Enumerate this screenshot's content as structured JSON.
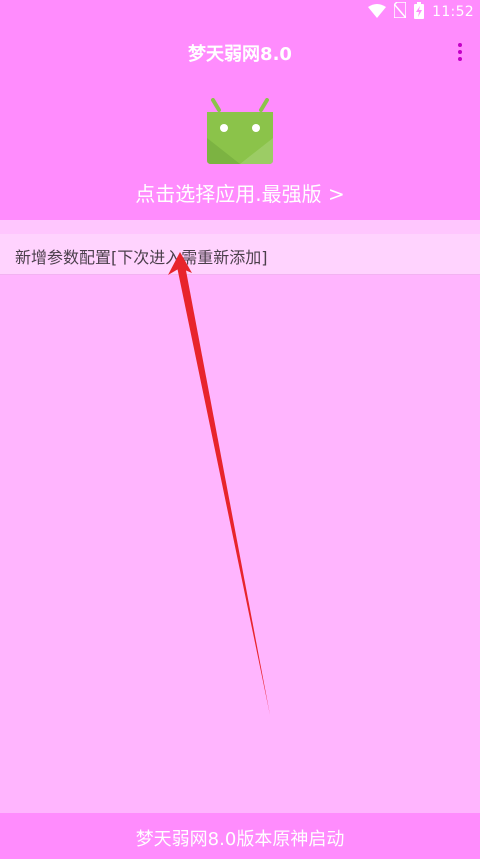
{
  "status_bar": {
    "time": "11:52",
    "icons": [
      "wifi-icon",
      "no-sim-icon",
      "battery-charging-icon"
    ]
  },
  "app_bar": {
    "title": "梦天弱网8.0",
    "menu_icon": "overflow-menu-icon"
  },
  "header": {
    "logo_icon": "android-icon",
    "select_app_label": "点击选择应用.最强版 >"
  },
  "list": {
    "items": [
      {
        "label": "新增参数配置[下次进入需重新添加]"
      }
    ]
  },
  "annotation": {
    "type": "red-arrow",
    "color": "#e8242c"
  },
  "bottom_bar": {
    "label": "梦天弱网8.0版本原神启动"
  },
  "colors": {
    "primary": "#ff8cfd",
    "background": "#ffb5fe",
    "list_item": "#ffd3fe",
    "accent": "#c400c7"
  }
}
